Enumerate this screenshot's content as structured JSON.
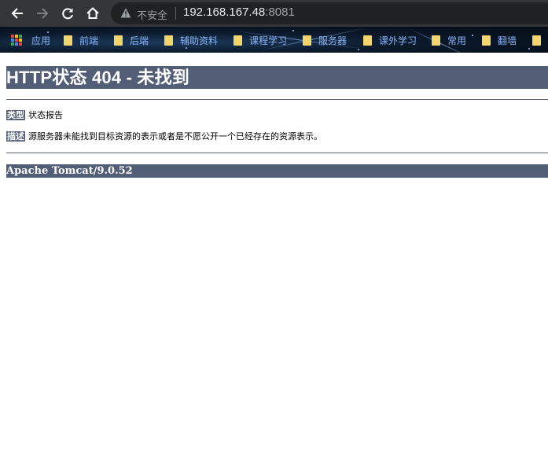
{
  "browser": {
    "security_label": "不安全",
    "url_host": "192.168.167.48",
    "url_port": ":8081",
    "bookmarks": [
      {
        "label": "应用",
        "type": "apps"
      },
      {
        "label": "前端",
        "type": "folder"
      },
      {
        "label": "后端",
        "type": "folder"
      },
      {
        "label": "辅助资料",
        "type": "folder"
      },
      {
        "label": "课程学习",
        "type": "folder"
      },
      {
        "label": "服务器",
        "type": "folder"
      },
      {
        "label": "课外学习",
        "type": "folder"
      },
      {
        "label": "常用",
        "type": "folder"
      },
      {
        "label": "翻墙",
        "type": "folder"
      }
    ]
  },
  "page": {
    "title": "HTTP状态 404 - 未找到",
    "type_label": "类型",
    "type_value": "状态报告",
    "desc_label": "描述",
    "desc_value": "源服务器未能找到目标资源的表示或者是不愿公开一个已经存在的资源表示。",
    "footer": "Apache Tomcat/9.0.52"
  },
  "colors": {
    "tomcat_header": "#525d76",
    "chrome_toolbar": "#35363a",
    "bookmark_text": "#8ab4f8",
    "folder": "#f4d56b"
  }
}
